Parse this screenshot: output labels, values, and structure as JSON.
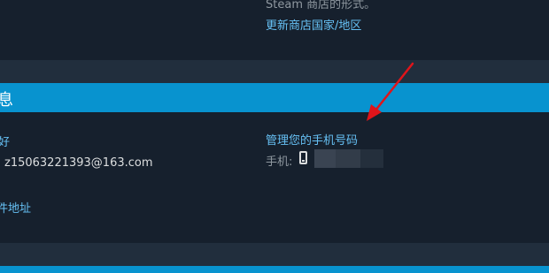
{
  "top_section": {
    "partial_text": "Steam 商店的形式。",
    "update_link": "更新商店国家/地区"
  },
  "info_section": {
    "title_fragment": "息",
    "cut_link_1": "好",
    "email": "z15063221393@163.com",
    "cut_link_2": "件地址"
  },
  "phone": {
    "manage_link": "管理您的手机号码",
    "label": "手机:"
  },
  "colors": {
    "accent_header": "#0893cf",
    "link": "#66c0f4",
    "annotation_arrow": "#e0141a"
  }
}
